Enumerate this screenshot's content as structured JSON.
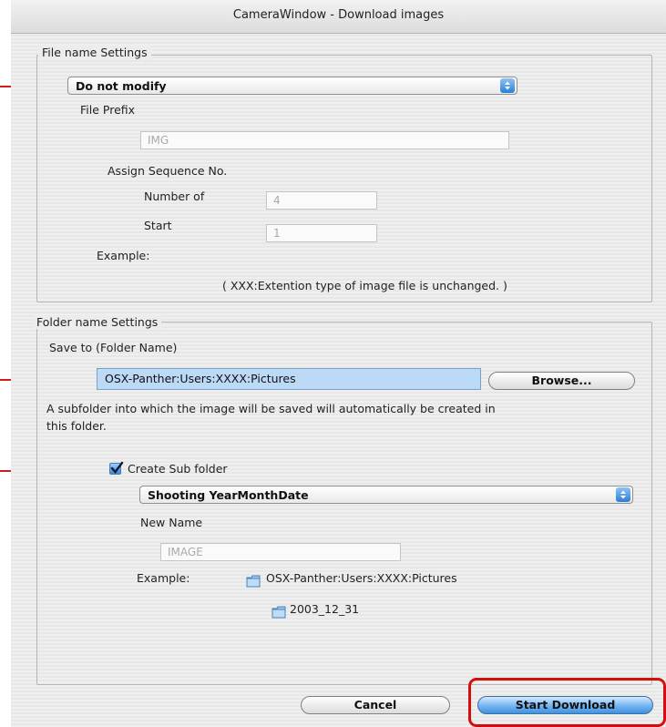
{
  "window": {
    "title": "CameraWindow - Download images"
  },
  "file_name_settings": {
    "group_label": "File name Settings",
    "mode_select": "Do not modify",
    "file_prefix_label": "File Prefix",
    "file_prefix_value": "IMG",
    "assign_sequence_label": "Assign Sequence No.",
    "number_of_label": "Number of",
    "number_of_value": "4",
    "start_label": "Start",
    "start_value": "1",
    "example_label": "Example:",
    "note": "( XXX:Extention type of image file is unchanged. )"
  },
  "folder_name_settings": {
    "group_label": "Folder name Settings",
    "save_to_label": "Save to (Folder Name)",
    "save_to_path": "OSX-Panther:Users:XXXX:Pictures",
    "browse_label": "Browse...",
    "info_line_1": "A subfolder into which the image will be saved will automatically be created in",
    "info_line_2": "this folder.",
    "create_sub_folder_label": "Create Sub folder",
    "create_sub_folder_checked": true,
    "sub_folder_select": "Shooting YearMonthDate",
    "new_name_label": "New Name",
    "new_name_value": "IMAGE",
    "example_label": "Example:",
    "example_path": "OSX-Panther:Users:XXXX:Pictures",
    "example_subfolder": "2003_12_31"
  },
  "footer": {
    "cancel_label": "Cancel",
    "start_download_label": "Start Download"
  },
  "colors": {
    "callout_red": "#cc1e1e",
    "aqua_blue": "#3f91e0",
    "path_field_highlight": "#bcd9f6"
  },
  "icons": {
    "select_arrows": "updown-arrows-icon",
    "checkbox": "checkmark-icon",
    "folder": "folder-icon"
  }
}
